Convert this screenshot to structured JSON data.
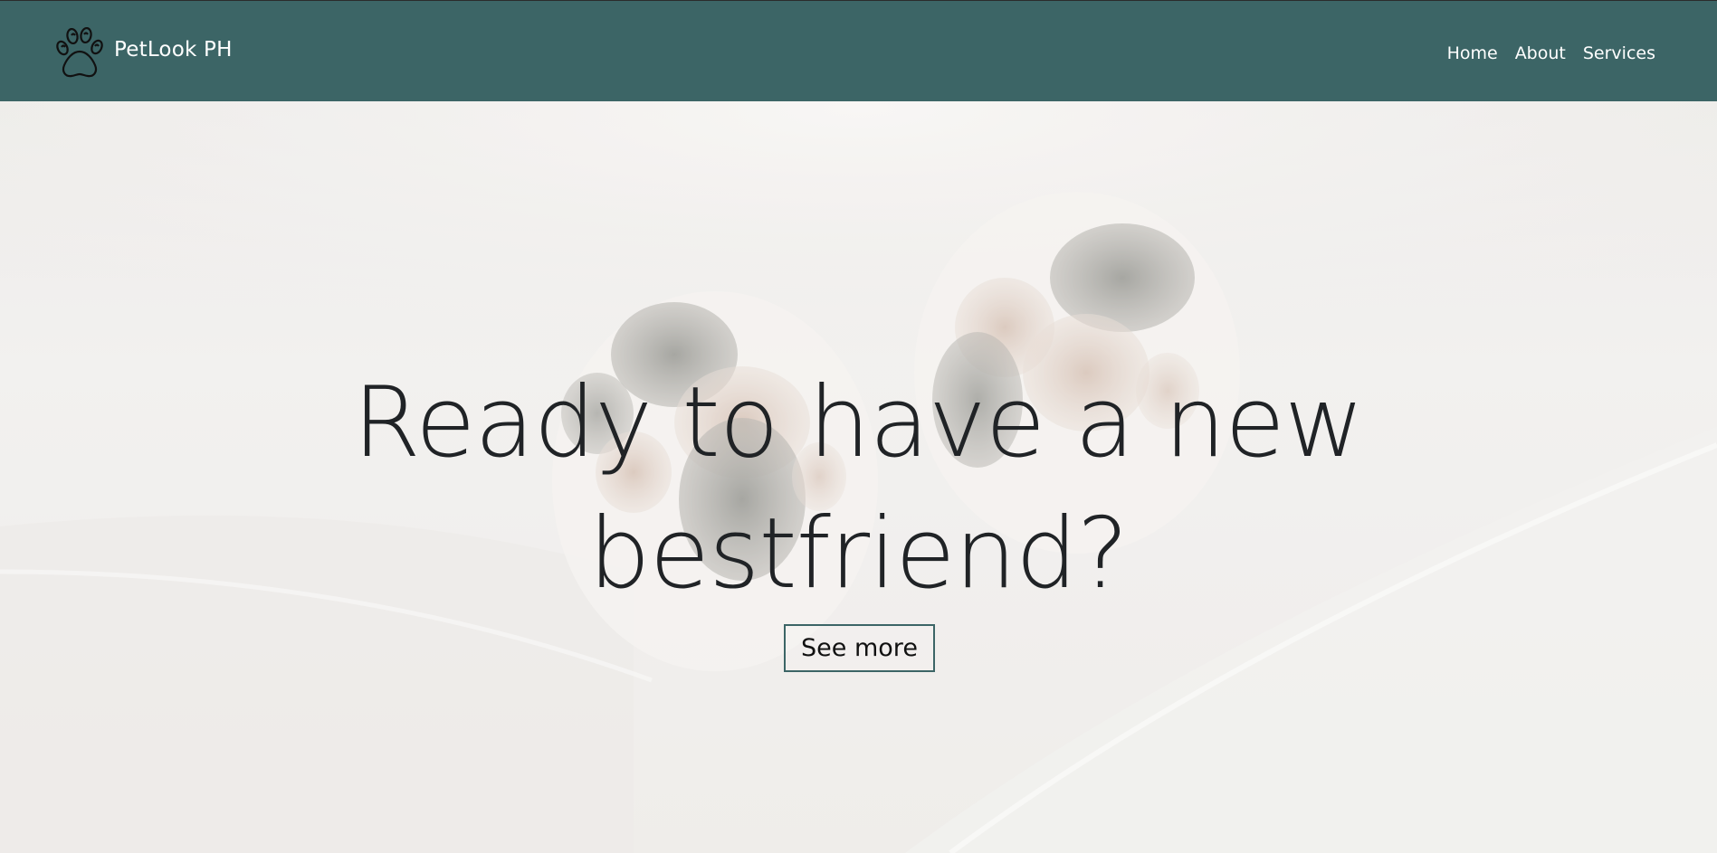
{
  "navbar": {
    "brand_name": "PetLook PH",
    "logo_icon": "paw-icon",
    "links": [
      {
        "label": "Home"
      },
      {
        "label": "About"
      },
      {
        "label": "Services"
      }
    ]
  },
  "hero": {
    "heading_line1": "Ready to have a new",
    "heading_line2": "bestfriend?",
    "button_label": "See more",
    "background": "white-fur-paws-photo"
  },
  "colors": {
    "navbar_bg": "#3c6566",
    "heading": "#202326",
    "button_border": "#3c6566"
  }
}
